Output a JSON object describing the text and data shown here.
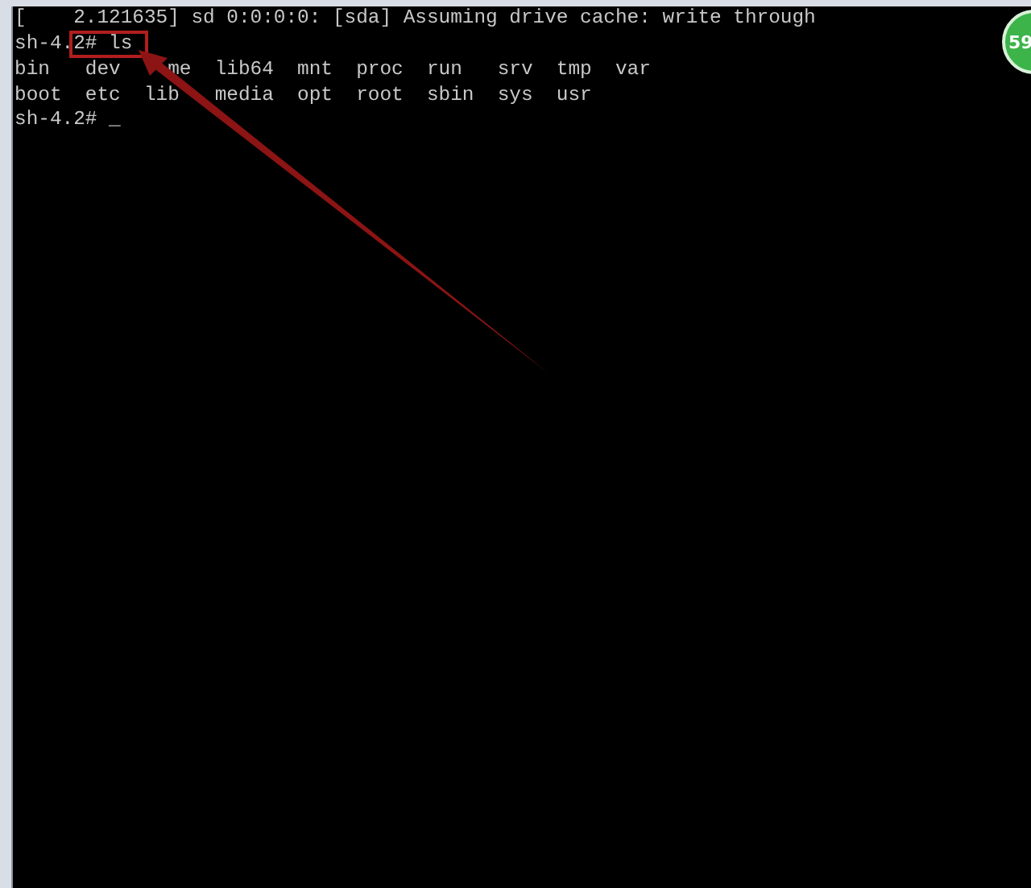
{
  "terminal": {
    "lines": [
      "[    2.121635] sd 0:0:0:0: [sda] Assuming drive cache: write through",
      {
        "text": "sh-4.",
        "marked": "2# ls"
      },
      "bin   dev    me  lib64  mnt  proc  run   srv  tmp  var",
      "boot  etc  lib   media  opt  root  sbin  sys  usr",
      "sh-4.2# _"
    ]
  },
  "badge": {
    "text": "59"
  },
  "annotation": {
    "kind": "arrow"
  }
}
